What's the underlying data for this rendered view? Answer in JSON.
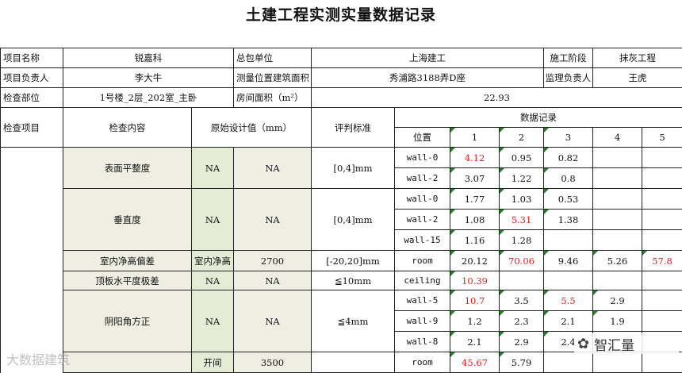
{
  "title": "土建工程实测实量数据记录",
  "info": {
    "project_name_label": "项目名称",
    "project_name": "锐嘉科",
    "contractor_label": "总包单位",
    "contractor": "上海建工",
    "stage_label": "施工阶段",
    "stage": "抹灰工程",
    "manager_label": "项目负责人",
    "manager": "李大牛",
    "location_label": "测量位置建筑面积",
    "location": "秀浦路3188弄D座",
    "supervisor_label": "监理负责人",
    "supervisor": "王虎",
    "part_label": "检查部位",
    "part": "1号楼_2层_202室_主卧",
    "area_label": "房间面积（m²）",
    "area": "22.93"
  },
  "headers": {
    "item": "检查项目",
    "content": "检查内容",
    "design": "原始设计值（mm）",
    "standard": "评判标准",
    "records": "数据记录",
    "position": "位置",
    "cols": [
      "1",
      "2",
      "3",
      "4",
      "5"
    ]
  },
  "groups": {
    "flatness": {
      "name": "表面平整度",
      "d1": "NA",
      "d2": "NA",
      "standard": "[0,4]mm",
      "rows": [
        {
          "pos": "wall-0",
          "v": [
            "4.12",
            "0.95",
            "0.82",
            "",
            ""
          ]
        },
        {
          "pos": "wall-2",
          "v": [
            "3.07",
            "1.22",
            "0.8",
            "",
            ""
          ]
        }
      ]
    },
    "vertical": {
      "name": "垂直度",
      "d1": "NA",
      "d2": "NA",
      "standard": "[0,4]mm",
      "rows": [
        {
          "pos": "wall-0",
          "v": [
            "1.77",
            "1.03",
            "0.53",
            "",
            ""
          ]
        },
        {
          "pos": "wall-2",
          "v": [
            "1.08",
            "5.31",
            "1.38",
            "",
            ""
          ]
        },
        {
          "pos": "wall-15",
          "v": [
            "1.16",
            "1.28",
            "",
            "",
            ""
          ]
        }
      ]
    },
    "height": {
      "name": "室内净高偏差",
      "d1": "室内净高",
      "d2": "2700",
      "standard": "[-20,20]mm",
      "rows": [
        {
          "pos": "room",
          "v": [
            "20.12",
            "70.06",
            "9.46",
            "5.26",
            "57.8"
          ]
        }
      ]
    },
    "ceiling": {
      "name": "顶板水平度极差",
      "d1": "NA",
      "d2": "NA",
      "standard": "≦10mm",
      "rows": [
        {
          "pos": "ceiling",
          "v": [
            "10.39",
            "",
            "",
            "",
            ""
          ]
        }
      ]
    },
    "corner": {
      "name": "阴阳角方正",
      "d1": "NA",
      "d2": "NA",
      "standard": "≦4mm",
      "rows": [
        {
          "pos": "wall-5",
          "v": [
            "10.7",
            "3.5",
            "5.5",
            "2.9",
            ""
          ]
        },
        {
          "pos": "wall-9",
          "v": [
            "1.2",
            "2.3",
            "2.1",
            "1.9",
            ""
          ]
        },
        {
          "pos": "wall-8",
          "v": [
            "2.1",
            "2.9",
            "2.4",
            "",
            ""
          ]
        }
      ]
    },
    "opening": {
      "name": "",
      "d1": "开间",
      "d2": "3500",
      "standard": "",
      "rows": [
        {
          "pos": "room",
          "v": [
            "45.67",
            "5.79",
            "",
            "",
            ""
          ]
        }
      ]
    }
  },
  "watermarks": {
    "left": "大数据建筑",
    "right": "智汇量"
  },
  "colors": {
    "beige": "#eeeee3",
    "green": "#e4ecd6",
    "red": "#dd2222",
    "mark": "#2c7a2c"
  }
}
